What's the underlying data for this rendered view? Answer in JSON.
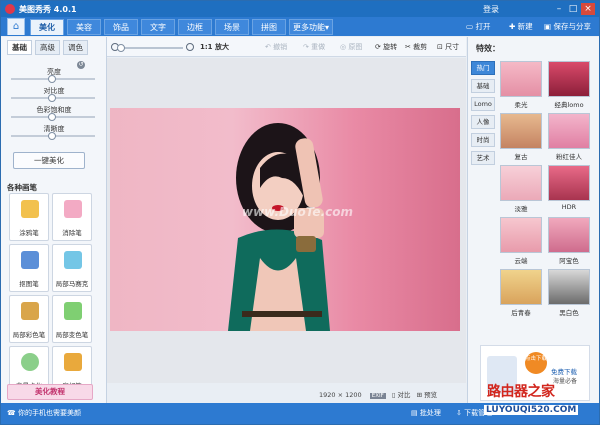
{
  "app": {
    "title": "美图秀秀 4.0.1",
    "login": "登录"
  },
  "nav": {
    "tabs": [
      "美化",
      "美容",
      "饰品",
      "文字",
      "边框",
      "场景",
      "拼图",
      "更多功能▾"
    ],
    "open": "打开",
    "new": "新建",
    "save": "保存与分享"
  },
  "toolbar": {
    "ratio": "1:1",
    "zoom_in": "放大",
    "undo": "撤销",
    "redo": "重做",
    "original": "原图",
    "rotate": "旋转",
    "crop": "裁剪",
    "size": "尺寸"
  },
  "left": {
    "tabs": [
      "基础",
      "高级",
      "调色"
    ],
    "adjust": [
      "亮度",
      "对比度",
      "色彩饱和度",
      "清晰度"
    ],
    "one_key": "一键美化",
    "pen_heading": "各种画笔",
    "pens": [
      "涂鸦笔",
      "消除笔",
      "抠图笔",
      "局部马赛克",
      "局部彩色笔",
      "局部变色笔",
      "背景虚化",
      "魔幻笔"
    ],
    "tutorial": "美化教程"
  },
  "canvas": {
    "watermark": "www.DuoTe.com",
    "resolution": "1920 × 1200",
    "compare": "对比",
    "preview": "预览"
  },
  "right": {
    "heading": "特效：",
    "tabs": [
      "热门",
      "基础",
      "Lomo",
      "人像",
      "时尚",
      "艺术"
    ],
    "effects": [
      "柔光",
      "经典lomo",
      "复古",
      "粉红佳人",
      "淡雅",
      "HDR",
      "云端",
      "阿宝色",
      "后青春",
      "黑白色"
    ],
    "ad_line1": "点击下载",
    "ad_line2": "免费下载",
    "ad_line3": "海量必备"
  },
  "status": {
    "left": "你的手机也需要美颜",
    "batch": "批处理",
    "download": "下载管理"
  },
  "brand": {
    "line1": "路由器之家",
    "line2": "LUYOUQI520.COM"
  },
  "colors": {
    "primary": "#2d7ad1",
    "accent": "#e0384a"
  }
}
